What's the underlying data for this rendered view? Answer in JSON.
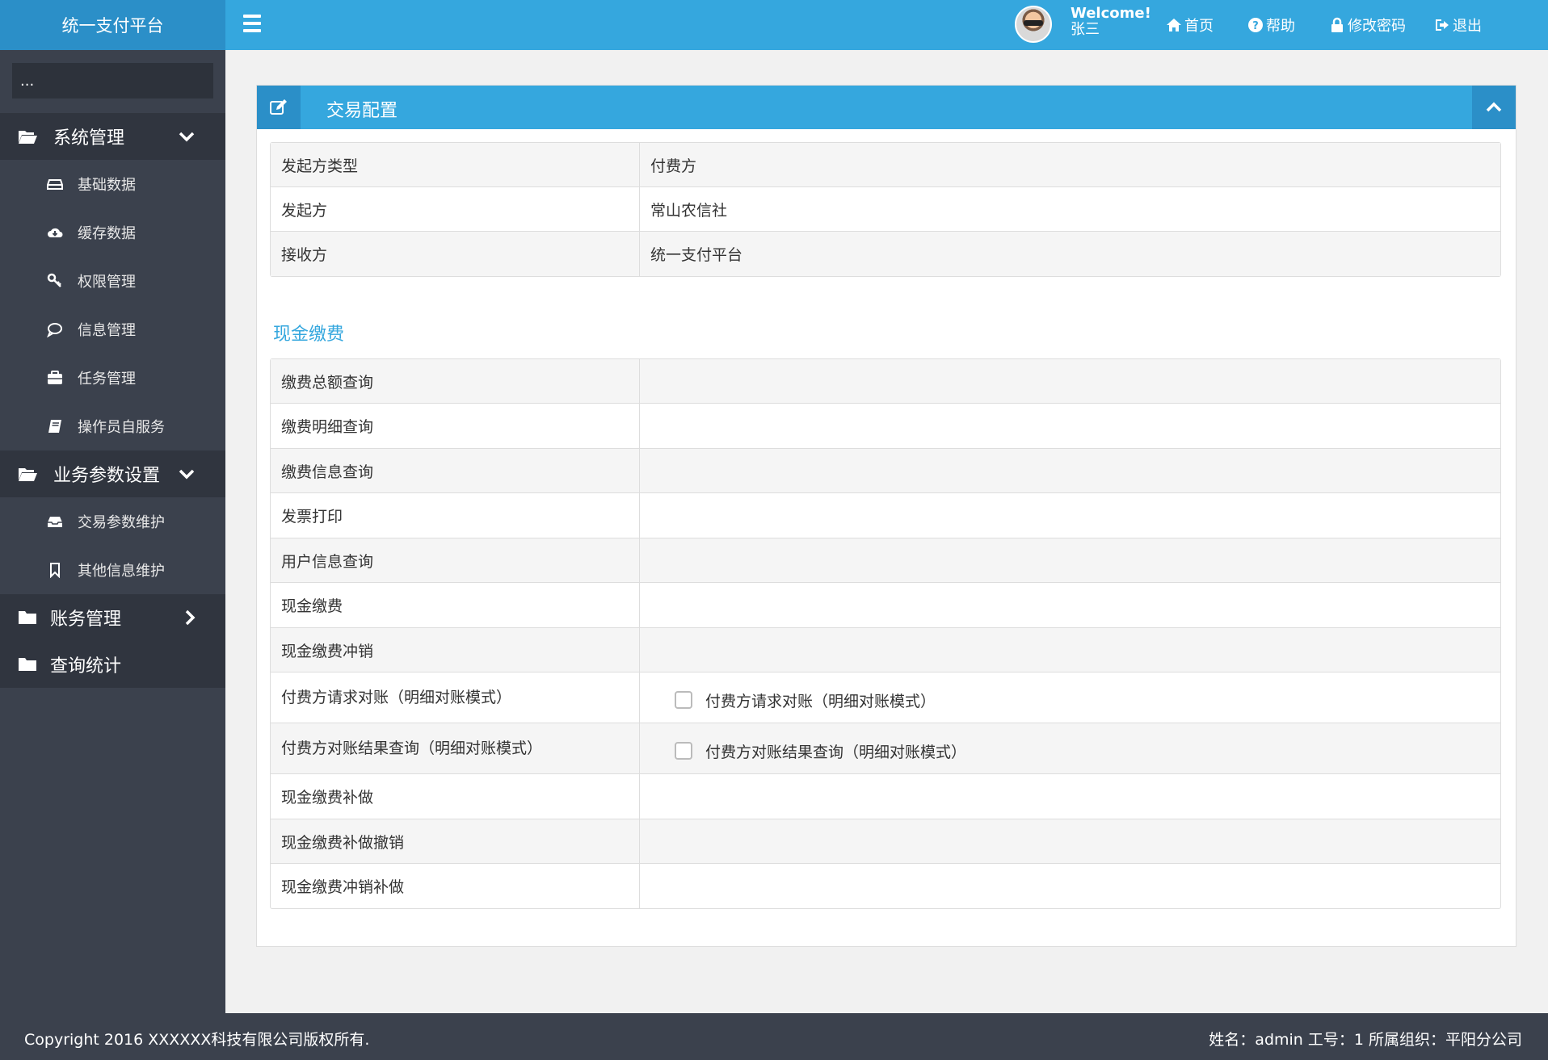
{
  "app": {
    "title": "统一支付平台"
  },
  "header": {
    "welcome": "Welcome!",
    "user": "张三",
    "links": {
      "home": "首页",
      "help": "帮助",
      "change_password": "修改密码",
      "logout": "退出"
    }
  },
  "sidebar": {
    "search_placeholder": "...",
    "groups": [
      {
        "label": "系统管理",
        "expanded": true,
        "items": [
          {
            "label": "基础数据",
            "icon": "hdd-icon"
          },
          {
            "label": "缓存数据",
            "icon": "cloud-download-icon"
          },
          {
            "label": "权限管理",
            "icon": "key-icon"
          },
          {
            "label": "信息管理",
            "icon": "comment-icon"
          },
          {
            "label": "任务管理",
            "icon": "briefcase-icon"
          },
          {
            "label": "操作员自服务",
            "icon": "book-icon"
          }
        ]
      },
      {
        "label": "业务参数设置",
        "expanded": true,
        "items": [
          {
            "label": "交易参数维护",
            "icon": "inbox-icon"
          },
          {
            "label": "其他信息维护",
            "icon": "bookmark-icon"
          }
        ]
      },
      {
        "label": "账务管理",
        "expanded": false,
        "items": []
      },
      {
        "label": "查询统计",
        "expanded": false,
        "items": []
      }
    ]
  },
  "panel": {
    "title": "交易配置",
    "info_rows": [
      {
        "key": "发起方类型",
        "value": "付费方"
      },
      {
        "key": "发起方",
        "value": "常山农信社"
      },
      {
        "key": "接收方",
        "value": "统一支付平台"
      }
    ],
    "section_title": "现金缴费",
    "txn_rows": [
      {
        "key": "缴费总额查询",
        "checkbox": null
      },
      {
        "key": "缴费明细查询",
        "checkbox": null
      },
      {
        "key": "缴费信息查询",
        "checkbox": null
      },
      {
        "key": "发票打印",
        "checkbox": null
      },
      {
        "key": "用户信息查询",
        "checkbox": null
      },
      {
        "key": "现金缴费",
        "checkbox": null
      },
      {
        "key": "现金缴费冲销",
        "checkbox": null
      },
      {
        "key": "付费方请求对账（明细对账模式）",
        "checkbox": "付费方请求对账（明细对账模式）",
        "checked": false
      },
      {
        "key": "付费方对账结果查询（明细对账模式）",
        "checkbox": "付费方对账结果查询（明细对账模式）",
        "checked": false
      },
      {
        "key": "现金缴费补做",
        "checkbox": null
      },
      {
        "key": "现金缴费补做撤销",
        "checkbox": null
      },
      {
        "key": "现金缴费冲销补做",
        "checkbox": null
      }
    ]
  },
  "footer": {
    "copyright": "Copyright  2016  XXXXXX科技有限公司版权所有.",
    "operator": "姓名：admin  工号：1  所属组织：平阳分公司"
  },
  "colors": {
    "primary": "#35a7de",
    "primary_dark": "#2b8fc8",
    "sidebar": "#3b414d",
    "sidebar_group": "#30353f"
  }
}
